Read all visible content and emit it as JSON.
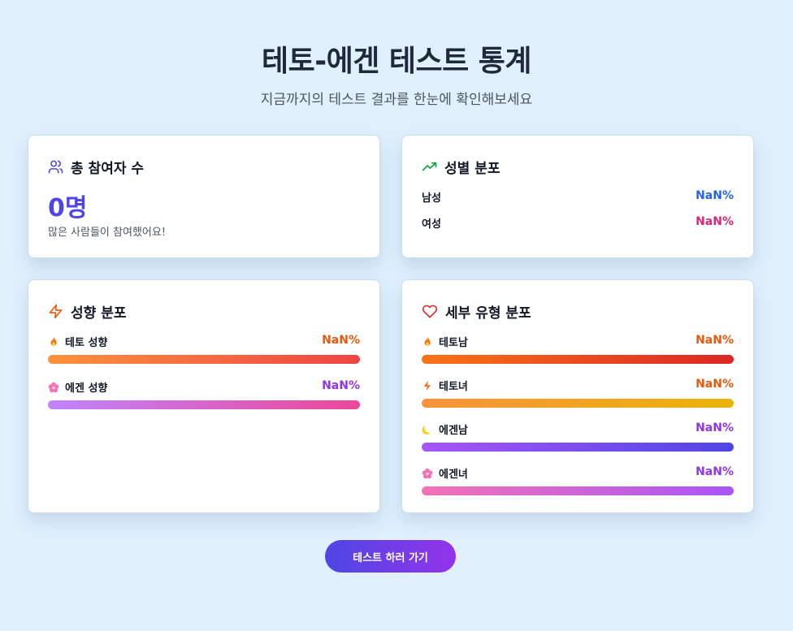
{
  "header": {
    "title": "테토-에겐 테스트 통계",
    "subtitle": "지금까지의 테스트 결과를 한눈에 확인해보세요"
  },
  "total_card": {
    "title": "총 참여자 수",
    "icon": "users-icon",
    "count": "0명",
    "note": "많은 사람들이 참여했어요!"
  },
  "gender_card": {
    "title": "성별 분포",
    "icon": "trending-up-icon",
    "rows": [
      {
        "label": "남성",
        "value": "NaN%",
        "color": "#2563eb"
      },
      {
        "label": "여성",
        "value": "NaN%",
        "color": "#db2777"
      }
    ]
  },
  "tendency_card": {
    "title": "성향 분포",
    "icon": "lightning-icon",
    "rows": [
      {
        "label": "테토 성향",
        "value": "NaN%",
        "icon": "fire-icon",
        "color": "#ea580c"
      },
      {
        "label": "에겐 성향",
        "value": "NaN%",
        "icon": "flower-icon",
        "color": "#9333ea"
      }
    ]
  },
  "type_card": {
    "title": "세부 유형 분포",
    "icon": "heart-icon",
    "rows": [
      {
        "label": "테토남",
        "value": "NaN%",
        "icon": "fire-icon",
        "color": "#ea580c"
      },
      {
        "label": "테토녀",
        "value": "NaN%",
        "icon": "lightning-icon",
        "color": "#ea580c"
      },
      {
        "label": "에겐남",
        "value": "NaN%",
        "icon": "moon-icon",
        "color": "#9333ea"
      },
      {
        "label": "에겐녀",
        "value": "NaN%",
        "icon": "flower-icon",
        "color": "#9333ea"
      }
    ]
  },
  "cta": {
    "label": "테스트 하러 가기"
  }
}
